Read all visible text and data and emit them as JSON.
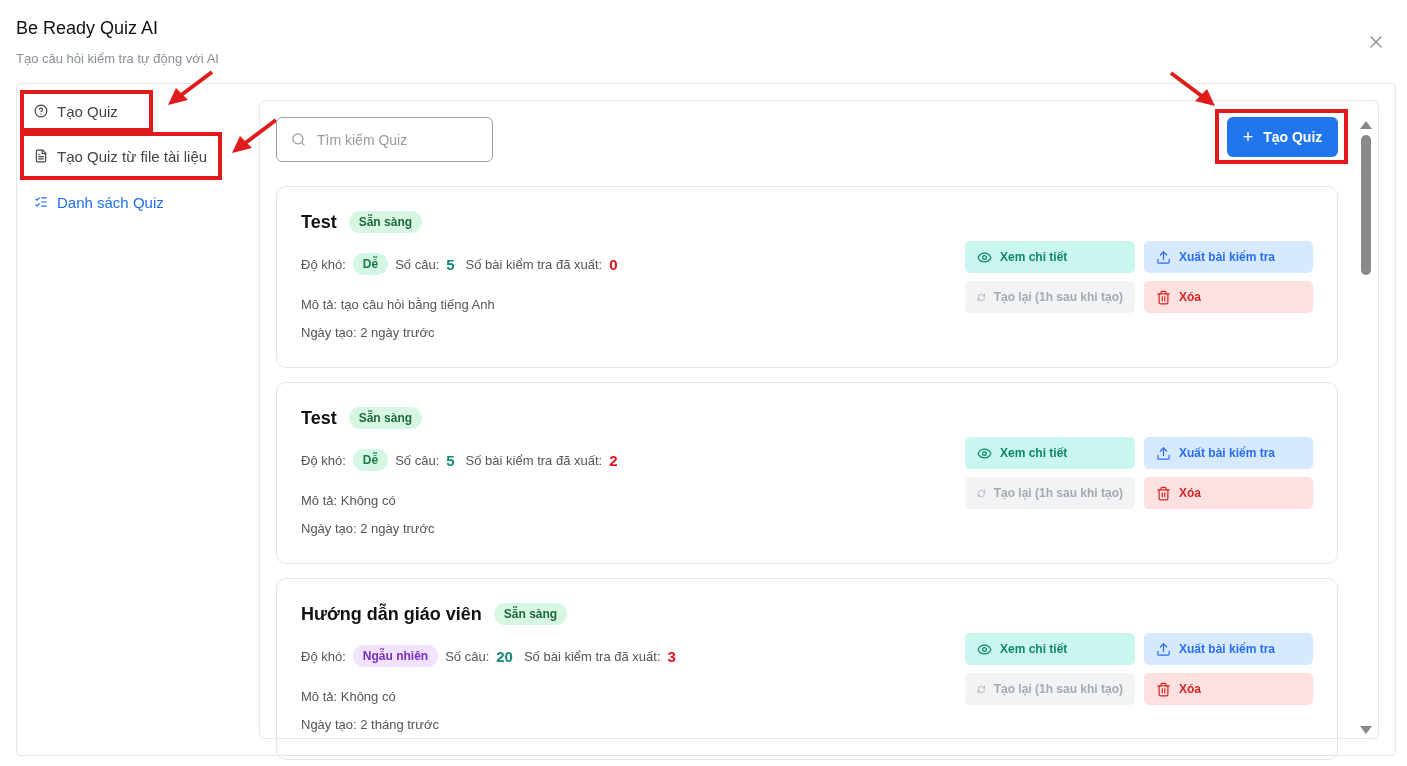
{
  "header": {
    "title": "Be Ready Quiz AI",
    "subtitle": "Tạo câu hỏi kiểm tra tự động với AI"
  },
  "sidebar": {
    "items": [
      {
        "label": "Tạo Quiz",
        "selected": false,
        "annotated": true
      },
      {
        "label": "Tạo Quiz từ file tài liệu",
        "selected": false,
        "annotated": true
      },
      {
        "label": "Danh sách Quiz",
        "selected": true,
        "annotated": false
      }
    ]
  },
  "search": {
    "placeholder": "Tìm kiếm Quiz"
  },
  "create_button": {
    "label": "Tạo Quiz",
    "icon": "+",
    "annotated": true
  },
  "quizzes": [
    {
      "title": "Test",
      "status": "Sẵn sàng",
      "difficulty_label": "Độ khó:",
      "difficulty": {
        "label": "Dễ",
        "kind": "easy"
      },
      "count_label": "Số câu:",
      "count": "5",
      "exported_label": "Số bài kiểm tra đã xuất:",
      "exported": "0",
      "description": "Mô tả: tạo câu hỏi bằng tiếng Anh",
      "created": "Ngày tạo: 2 ngày trước",
      "actions": [
        {
          "label": "Xem chi tiết",
          "kind": "view",
          "disabled": false
        },
        {
          "label": "Xuất bài kiểm tra",
          "kind": "export",
          "disabled": false
        },
        {
          "label": "Tạo lại (1h sau khi tạo)",
          "kind": "retry",
          "disabled": true
        },
        {
          "label": "Xóa",
          "kind": "delete",
          "disabled": false
        }
      ]
    },
    {
      "title": "Test",
      "status": "Sẵn sàng",
      "difficulty_label": "Độ khó:",
      "difficulty": {
        "label": "Dễ",
        "kind": "easy"
      },
      "count_label": "Số câu:",
      "count": "5",
      "exported_label": "Số bài kiểm tra đã xuất:",
      "exported": "2",
      "description": "Mô tả: Không có",
      "created": "Ngày tạo: 2 ngày trước",
      "actions": [
        {
          "label": "Xem chi tiết",
          "kind": "view",
          "disabled": false
        },
        {
          "label": "Xuất bài kiểm tra",
          "kind": "export",
          "disabled": false
        },
        {
          "label": "Tạo lại (1h sau khi tạo)",
          "kind": "retry",
          "disabled": true
        },
        {
          "label": "Xóa",
          "kind": "delete",
          "disabled": false
        }
      ]
    },
    {
      "title": "Hướng dẫn giáo viên",
      "status": "Sẵn sàng",
      "difficulty_label": "Độ khó:",
      "difficulty": {
        "label": "Ngẫu nhiên",
        "kind": "random"
      },
      "count_label": "Số câu:",
      "count": "20",
      "exported_label": "Số bài kiểm tra đã xuất:",
      "exported": "3",
      "description": "Mô tả: Không có",
      "created": "Ngày tạo: 2 tháng trước",
      "actions": [
        {
          "label": "Xem chi tiết",
          "kind": "view",
          "disabled": false
        },
        {
          "label": "Xuất bài kiểm tra",
          "kind": "export",
          "disabled": false
        },
        {
          "label": "Tạo lại (1h sau khi tạo)",
          "kind": "retry",
          "disabled": true
        },
        {
          "label": "Xóa",
          "kind": "delete",
          "disabled": false
        }
      ]
    }
  ]
}
